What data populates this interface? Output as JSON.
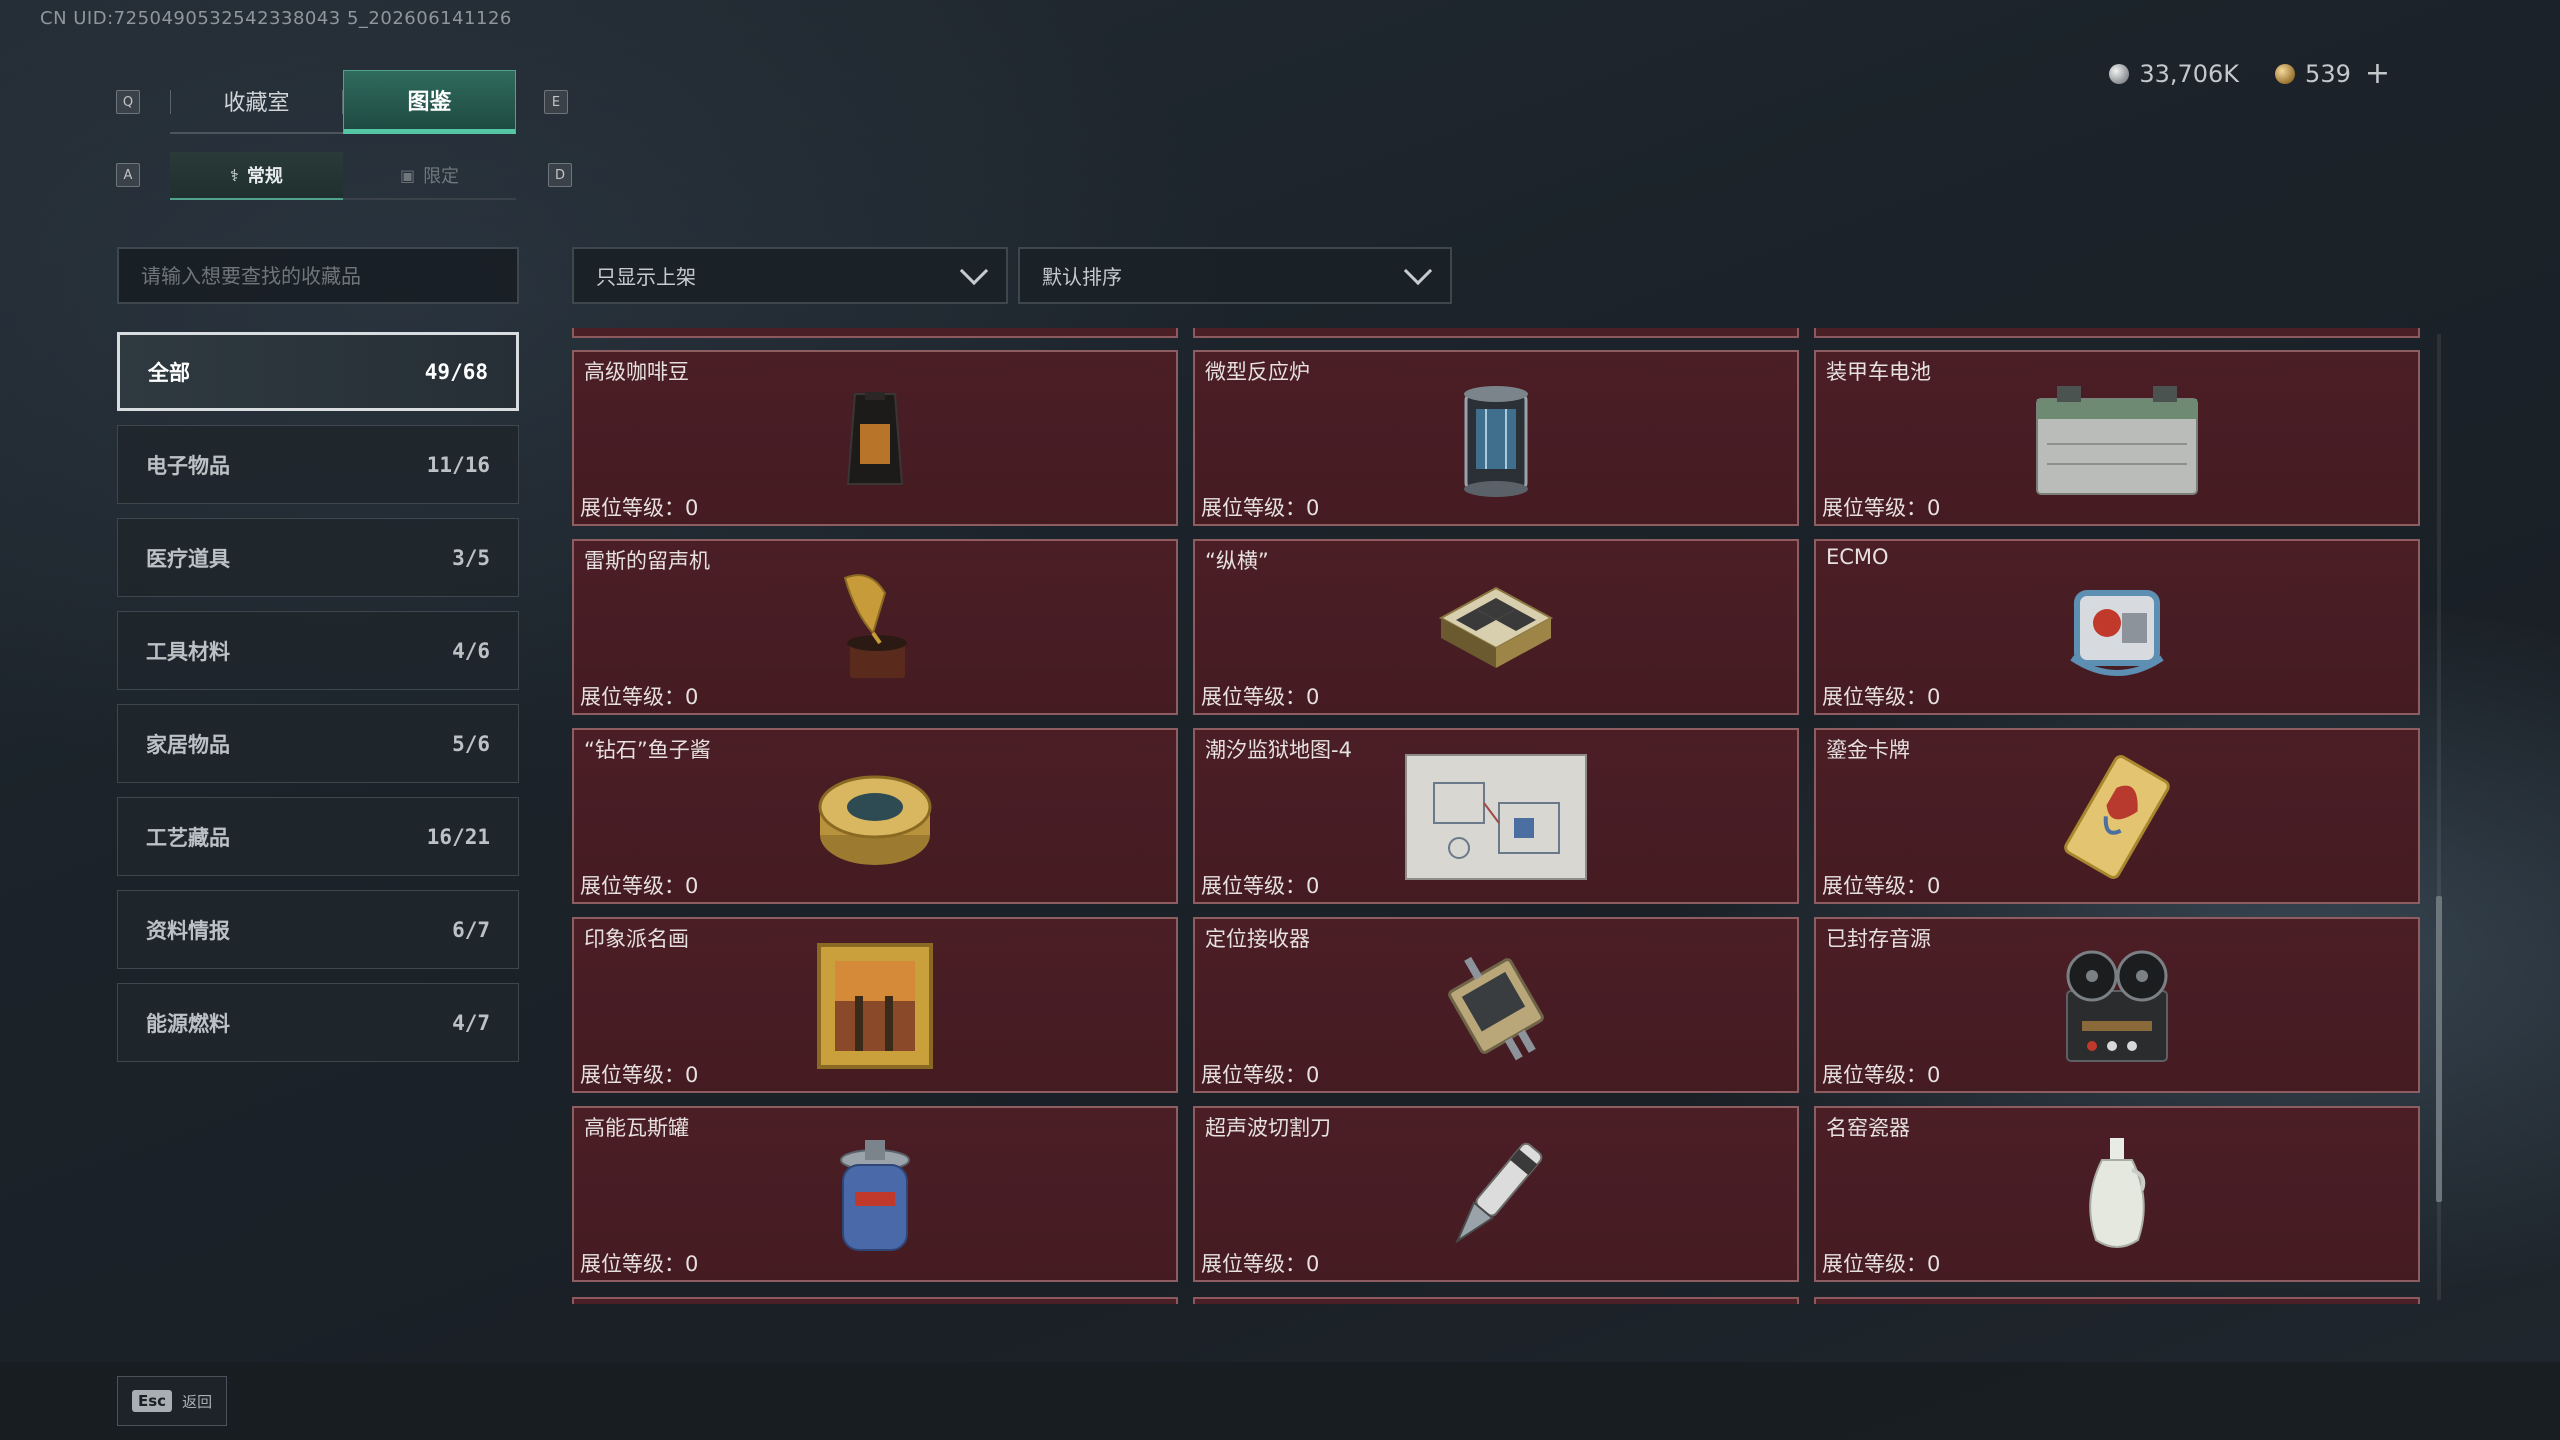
{
  "uid_text": "CN UID:7250490532542338043 5_202606141126",
  "currency": {
    "silver": "33,706K",
    "gold": "539",
    "plus": "+"
  },
  "keys": {
    "q": "Q",
    "e": "E",
    "a": "A",
    "d": "D"
  },
  "main_tabs": [
    {
      "label": "收藏室"
    },
    {
      "label": "图鉴"
    }
  ],
  "sub_tabs": [
    {
      "label": "常规"
    },
    {
      "label": "限定"
    }
  ],
  "search": {
    "placeholder": "请输入想要查找的收藏品"
  },
  "categories": [
    {
      "label": "全部",
      "count": "49/68"
    },
    {
      "label": "电子物品",
      "count": "11/16"
    },
    {
      "label": "医疗道具",
      "count": "3/5"
    },
    {
      "label": "工具材料",
      "count": "4/6"
    },
    {
      "label": "家居物品",
      "count": "5/6"
    },
    {
      "label": "工艺藏品",
      "count": "16/21"
    },
    {
      "label": "资料情报",
      "count": "6/7"
    },
    {
      "label": "能源燃料",
      "count": "4/7"
    }
  ],
  "filters": {
    "filter_label": "只显示上架",
    "sort_label": "默认排序"
  },
  "level_label": "展位等级：0",
  "items": [
    {
      "name": "高级咖啡豆",
      "icon": "coffee-bag-icon"
    },
    {
      "name": "微型反应炉",
      "icon": "reactor-icon"
    },
    {
      "name": "装甲车电池",
      "icon": "battery-icon"
    },
    {
      "name": "雷斯的留声机",
      "icon": "gramophone-icon"
    },
    {
      "name": "“纵横”",
      "icon": "chessboard-icon"
    },
    {
      "name": "ECMO",
      "icon": "ecmo-machine-icon"
    },
    {
      "name": "“钻石”鱼子酱",
      "icon": "caviar-tin-icon"
    },
    {
      "name": "潮汐监狱地图-4",
      "icon": "map-icon"
    },
    {
      "name": "鎏金卡牌",
      "icon": "gold-card-icon"
    },
    {
      "name": "印象派名画",
      "icon": "painting-icon"
    },
    {
      "name": "定位接收器",
      "icon": "receiver-icon"
    },
    {
      "name": "已封存音源",
      "icon": "tape-recorder-icon"
    },
    {
      "name": "高能瓦斯罐",
      "icon": "gas-tank-icon"
    },
    {
      "name": "超声波切割刀",
      "icon": "cutter-icon"
    },
    {
      "name": "名窑瓷器",
      "icon": "porcelain-vase-icon"
    }
  ],
  "footer": {
    "esc_key": "Esc",
    "esc_label": "返回"
  }
}
